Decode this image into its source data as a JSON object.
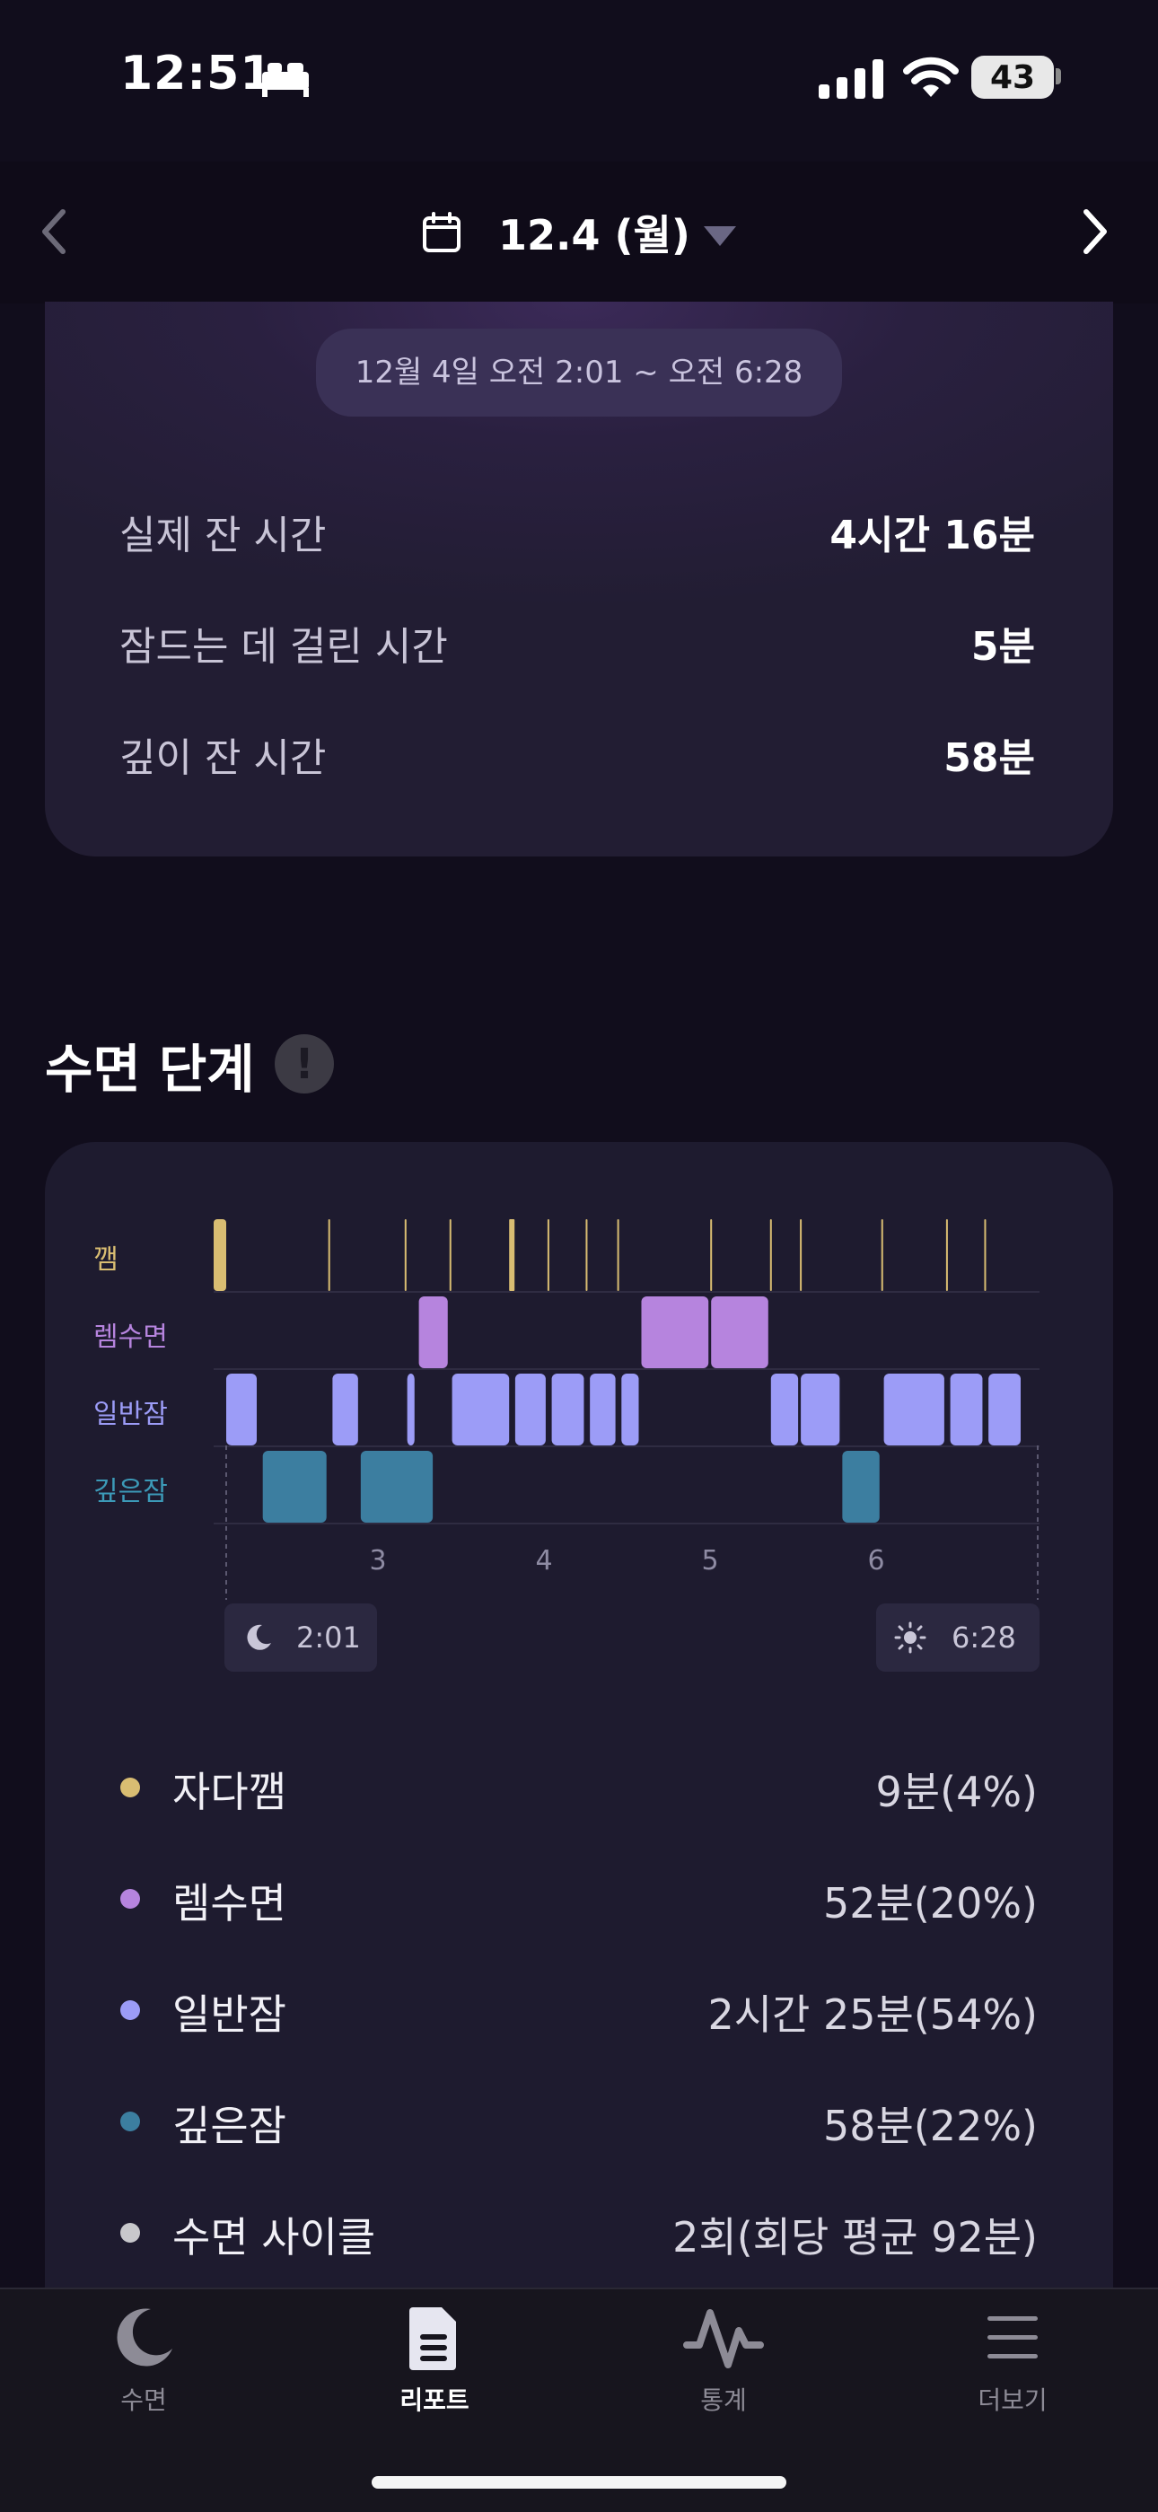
{
  "status_bar": {
    "time": "12:51",
    "battery": "43"
  },
  "header": {
    "date": "12.4 (월)"
  },
  "summary": {
    "range": "12월 4일 오전 2:01 ~ 오전 6:28",
    "rows": [
      {
        "label": "실제 잔 시간",
        "value": "4시간 16분"
      },
      {
        "label": "잠드는 데 걸린 시간",
        "value": "5분"
      },
      {
        "label": "깊이 잔 시간",
        "value": "58분"
      }
    ]
  },
  "stages_section": {
    "title": "수면 단계",
    "info_icon": "exclamation-circle-icon"
  },
  "colors": {
    "awake": "#d9bd72",
    "rem": "#b684de",
    "light": "#9c9cf7",
    "deep": "#3c7ea0",
    "cycle": "#c8c8cc"
  },
  "chart_data": {
    "type": "hypnogram",
    "stages": [
      "깸",
      "렘수면",
      "일반잠",
      "깊은잠"
    ],
    "x_unit": "hour",
    "x_ticks": [
      "3",
      "4",
      "5",
      "6"
    ],
    "start_label": "2:01",
    "end_label": "6:28",
    "awake_marks": [
      2.0,
      2.62,
      3.08,
      3.35,
      3.72,
      3.94,
      4.17,
      4.36,
      4.92,
      5.28,
      5.46,
      5.95,
      6.34,
      6.57
    ],
    "segments": [
      {
        "stage": "일반잠",
        "start": 2.0,
        "end": 2.2
      },
      {
        "stage": "깊은잠",
        "start": 2.22,
        "end": 2.62
      },
      {
        "stage": "일반잠",
        "start": 2.64,
        "end": 2.81
      },
      {
        "stage": "깊은잠",
        "start": 2.81,
        "end": 3.26
      },
      {
        "stage": "일반잠",
        "start": 3.09,
        "end": 3.15
      },
      {
        "stage": "렘수면",
        "start": 3.16,
        "end": 3.35
      },
      {
        "stage": "일반잠",
        "start": 3.36,
        "end": 3.72
      },
      {
        "stage": "일반잠",
        "start": 3.74,
        "end": 3.94
      },
      {
        "stage": "일반잠",
        "start": 3.96,
        "end": 4.17
      },
      {
        "stage": "일반잠",
        "start": 4.19,
        "end": 4.36
      },
      {
        "stage": "일반잠",
        "start": 4.38,
        "end": 4.5
      },
      {
        "stage": "렘수면",
        "start": 4.5,
        "end": 4.92
      },
      {
        "stage": "렘수면",
        "start": 4.92,
        "end": 5.28
      },
      {
        "stage": "일반잠",
        "start": 5.28,
        "end": 5.46
      },
      {
        "stage": "일반잠",
        "start": 5.46,
        "end": 5.71
      },
      {
        "stage": "깊은잠",
        "start": 5.71,
        "end": 5.95
      },
      {
        "stage": "일반잠",
        "start": 5.96,
        "end": 6.34
      },
      {
        "stage": "일반잠",
        "start": 6.36,
        "end": 6.57
      },
      {
        "stage": "일반잠",
        "start": 6.59,
        "end": 6.8
      }
    ]
  },
  "legend": [
    {
      "name": "자다깸",
      "value": "9분(4%)",
      "color_key": "awake"
    },
    {
      "name": "렘수면",
      "value": "52분(20%)",
      "color_key": "rem"
    },
    {
      "name": "일반잠",
      "value": "2시간 25분(54%)",
      "color_key": "light"
    },
    {
      "name": "깊은잠",
      "value": "58분(22%)",
      "color_key": "deep"
    },
    {
      "name": "수면 사이클",
      "value": "2회(회당 평균 92분)",
      "color_key": "cycle"
    }
  ],
  "tabs": [
    {
      "label": "수면",
      "icon": "moon-icon",
      "active": false
    },
    {
      "label": "리포트",
      "icon": "report-icon",
      "active": true
    },
    {
      "label": "통계",
      "icon": "stats-icon",
      "active": false
    },
    {
      "label": "더보기",
      "icon": "menu-icon",
      "active": false
    }
  ]
}
